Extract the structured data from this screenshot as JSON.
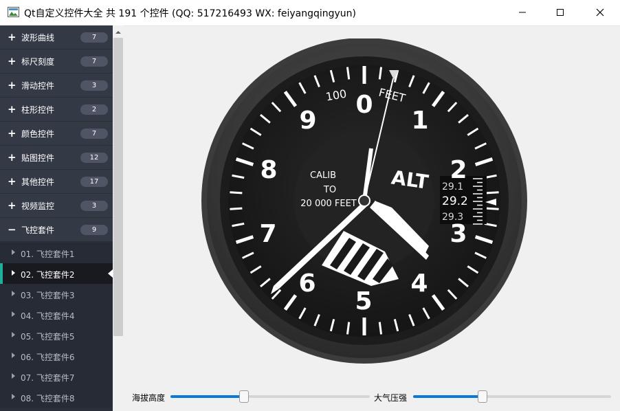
{
  "window": {
    "title": "Qt自定义控件大全 共 191 个控件 (QQ: 517216493 WX: feiyangqingyun)"
  },
  "sidebar": {
    "categories": [
      {
        "label": "波形曲线",
        "count": "7"
      },
      {
        "label": "标尺刻度",
        "count": "7"
      },
      {
        "label": "滑动控件",
        "count": "3"
      },
      {
        "label": "柱形控件",
        "count": "2"
      },
      {
        "label": "颜色控件",
        "count": "7"
      },
      {
        "label": "贴图控件",
        "count": "12"
      },
      {
        "label": "其他控件",
        "count": "17"
      },
      {
        "label": "视频监控",
        "count": "3"
      },
      {
        "label": "飞控套件",
        "count": "9"
      }
    ],
    "expanded_glyph": "−",
    "collapsed_glyph": "+",
    "subitems": [
      {
        "label": "01. 飞控套件1"
      },
      {
        "label": "02. 飞控套件2"
      },
      {
        "label": "03. 飞控套件3"
      },
      {
        "label": "04. 飞控套件4"
      },
      {
        "label": "05. 飞控套件5"
      },
      {
        "label": "06. 飞控套件6"
      },
      {
        "label": "07. 飞控套件7"
      },
      {
        "label": "08. 飞控套件8"
      }
    ],
    "selected_index": 1
  },
  "gauge": {
    "numerals": [
      "0",
      "1",
      "2",
      "3",
      "4",
      "5",
      "6",
      "7",
      "8",
      "9"
    ],
    "top_unit": "FEET",
    "top_scale": "100",
    "center_label": "ALT",
    "calib_line1": "CALIB",
    "calib_line2": "TO",
    "calib_line3": "20 000 FEET",
    "baro_values": [
      "29.1",
      "29.2",
      "29.3"
    ]
  },
  "controls": {
    "altitude_label": "海拔高度",
    "altitude_value": 0.37,
    "pressure_label": "大气压强",
    "pressure_value": 0.35
  },
  "colors": {
    "accent": "#1db19b",
    "slider_fill": "#0b79d6",
    "sidebar_bg": "#2a2e39"
  }
}
